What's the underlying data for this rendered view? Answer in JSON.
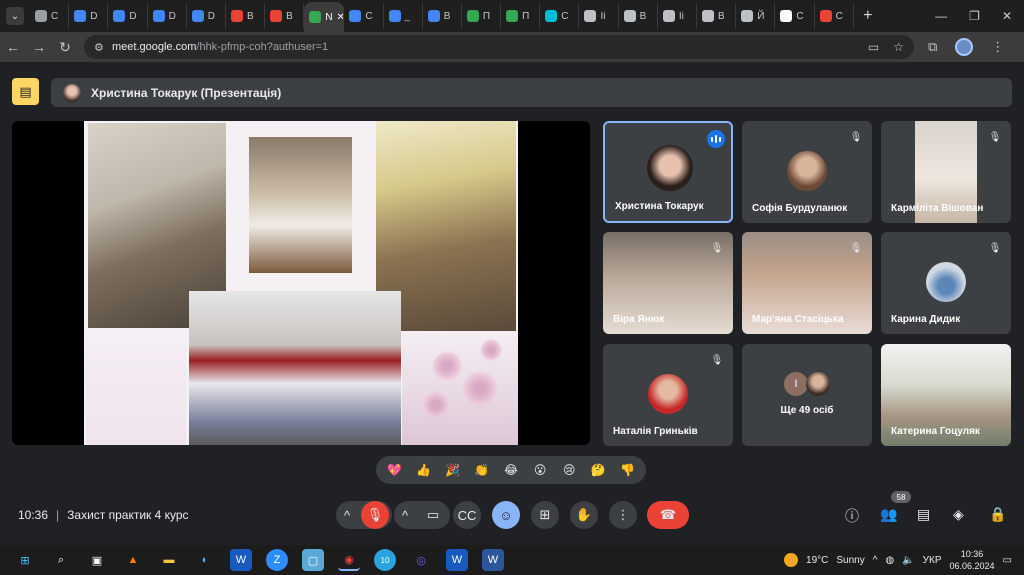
{
  "browser": {
    "tabs": [
      {
        "label": "С",
        "color": "#9aa0a6"
      },
      {
        "label": "D",
        "color": "#4285f4"
      },
      {
        "label": "D",
        "color": "#4285f4"
      },
      {
        "label": "D",
        "color": "#4285f4"
      },
      {
        "label": "D",
        "color": "#4285f4"
      },
      {
        "label": "В",
        "color": "#ea4335"
      },
      {
        "label": "В",
        "color": "#ea4335"
      },
      {
        "label": "N",
        "color": "#34a853",
        "active": true
      },
      {
        "label": "С",
        "color": "#4285f4"
      },
      {
        "label": "_",
        "color": "#4285f4"
      },
      {
        "label": "В",
        "color": "#4285f4"
      },
      {
        "label": "П",
        "color": "#34a853"
      },
      {
        "label": "П",
        "color": "#34a853"
      },
      {
        "label": "С",
        "color": "#00bcd4"
      },
      {
        "label": "Іі",
        "color": "#bdc1c6"
      },
      {
        "label": "В",
        "color": "#bdc1c6"
      },
      {
        "label": "Іі",
        "color": "#bdc1c6"
      },
      {
        "label": "В",
        "color": "#bdc1c6"
      },
      {
        "label": "Й",
        "color": "#bdc1c6"
      },
      {
        "label": "С",
        "color": "#ffffff"
      },
      {
        "label": "С",
        "color": "#ea4335"
      }
    ],
    "new_tab": "+",
    "url_host": "meet.google.com",
    "url_path": "/hhk-pfmp-coh?authuser=1"
  },
  "presentation": {
    "presenter_title": "Христина Токарук (Презентація)"
  },
  "participants": [
    {
      "name": "Христина Токарук",
      "speaking": true
    },
    {
      "name": "Софія Бурдуланюк",
      "muted": true
    },
    {
      "name": "Карміліта Вішован",
      "muted": true
    },
    {
      "name": "Віра Янюк",
      "muted": true
    },
    {
      "name": "Мар'яна Стасіцька",
      "muted": true
    },
    {
      "name": "Карина Дидик",
      "muted": true
    },
    {
      "name": "Наталія Гриньків",
      "muted": true
    },
    {
      "name": "Ще 49 осіб",
      "avatar_letter": "І"
    },
    {
      "name": "Катерина Гоцуляк",
      "muted": true
    }
  ],
  "reactions": [
    "💖",
    "👍",
    "🎉",
    "👏",
    "😂",
    "😮",
    "😢",
    "🤔",
    "👎"
  ],
  "controls": {
    "time": "10:36",
    "meeting_title": "Захист практик 4 курс",
    "participant_count": "58"
  },
  "taskbar": {
    "weather_temp": "19°C",
    "weather_desc": "Sunny",
    "lang": "УКР",
    "clock_time": "10:36",
    "clock_date": "06.06.2024",
    "badge_count": "10"
  }
}
